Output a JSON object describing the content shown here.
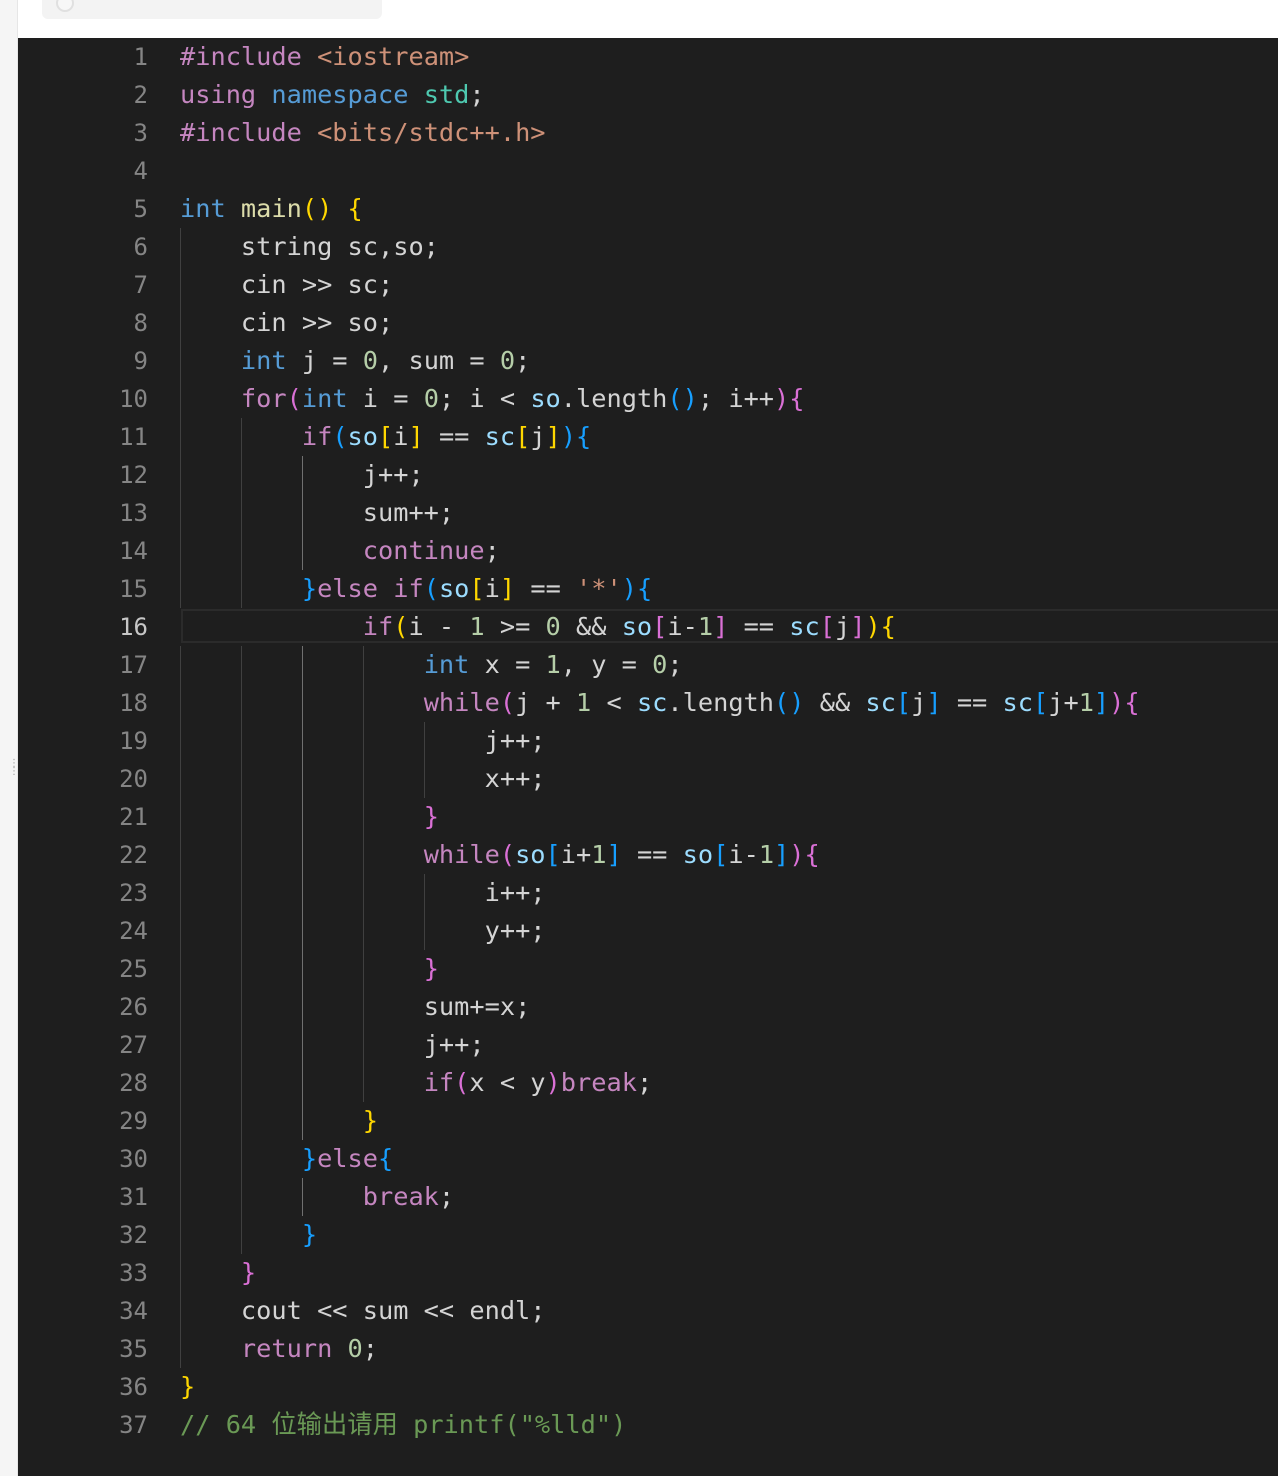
{
  "editor": {
    "active_line": 16,
    "lines": [
      [
        [
          "#include ",
          "#c586c0"
        ],
        [
          "<iostream>",
          "#ce9178"
        ]
      ],
      [
        [
          "using ",
          "#c586c0"
        ],
        [
          "namespace ",
          "#569cd6"
        ],
        [
          "std",
          "#4ec9b0"
        ],
        [
          ";",
          "#d4d4d4"
        ]
      ],
      [
        [
          "#include ",
          "#c586c0"
        ],
        [
          "<bits/stdc++.h>",
          "#ce9178"
        ]
      ],
      [],
      [
        [
          "int ",
          "#569cd6"
        ],
        [
          "main",
          "#dcdcaa"
        ],
        [
          "() ",
          "#ffd700"
        ],
        [
          "{",
          "#ffd700"
        ]
      ],
      [
        [
          "    ",
          "#d4d4d4"
        ],
        [
          "string sc,so;",
          "#d4d4d4"
        ]
      ],
      [
        [
          "    ",
          "#d4d4d4"
        ],
        [
          "cin >> sc;",
          "#d4d4d4"
        ]
      ],
      [
        [
          "    ",
          "#d4d4d4"
        ],
        [
          "cin >> so;",
          "#d4d4d4"
        ]
      ],
      [
        [
          "    ",
          "#d4d4d4"
        ],
        [
          "int ",
          "#569cd6"
        ],
        [
          "j = ",
          "#d4d4d4"
        ],
        [
          "0",
          "#b5cea8"
        ],
        [
          ", sum = ",
          "#d4d4d4"
        ],
        [
          "0",
          "#b5cea8"
        ],
        [
          ";",
          "#d4d4d4"
        ]
      ],
      [
        [
          "    ",
          "#d4d4d4"
        ],
        [
          "for",
          "#c586c0"
        ],
        [
          "(",
          "#da70d6"
        ],
        [
          "int ",
          "#569cd6"
        ],
        [
          "i = ",
          "#d4d4d4"
        ],
        [
          "0",
          "#b5cea8"
        ],
        [
          "; i < ",
          "#d4d4d4"
        ],
        [
          "so",
          "#9cdcfe"
        ],
        [
          ".length",
          "#d4d4d4"
        ],
        [
          "()",
          "#179fff"
        ],
        [
          "; i++",
          "#d4d4d4"
        ],
        [
          "){",
          "#da70d6"
        ]
      ],
      [
        [
          "        ",
          "#d4d4d4"
        ],
        [
          "if",
          "#c586c0"
        ],
        [
          "(",
          "#179fff"
        ],
        [
          "so",
          "#9cdcfe"
        ],
        [
          "[",
          "#ffd700"
        ],
        [
          "i",
          "#d4d4d4"
        ],
        [
          "]",
          "#ffd700"
        ],
        [
          " == ",
          "#d4d4d4"
        ],
        [
          "sc",
          "#9cdcfe"
        ],
        [
          "[",
          "#ffd700"
        ],
        [
          "j",
          "#d4d4d4"
        ],
        [
          "]",
          "#ffd700"
        ],
        [
          "){",
          "#179fff"
        ]
      ],
      [
        [
          "            ",
          "#d4d4d4"
        ],
        [
          "j++;",
          "#d4d4d4"
        ]
      ],
      [
        [
          "            ",
          "#d4d4d4"
        ],
        [
          "sum++;",
          "#d4d4d4"
        ]
      ],
      [
        [
          "            ",
          "#d4d4d4"
        ],
        [
          "continue",
          "#c586c0"
        ],
        [
          ";",
          "#d4d4d4"
        ]
      ],
      [
        [
          "        ",
          "#d4d4d4"
        ],
        [
          "}",
          "#179fff"
        ],
        [
          "else ",
          "#c586c0"
        ],
        [
          "if",
          "#c586c0"
        ],
        [
          "(",
          "#179fff"
        ],
        [
          "so",
          "#9cdcfe"
        ],
        [
          "[",
          "#ffd700"
        ],
        [
          "i",
          "#d4d4d4"
        ],
        [
          "]",
          "#ffd700"
        ],
        [
          " == ",
          "#d4d4d4"
        ],
        [
          "'*'",
          "#ce9178"
        ],
        [
          "){",
          "#179fff"
        ]
      ],
      [
        [
          "            ",
          "#d4d4d4"
        ],
        [
          "if",
          "#c586c0"
        ],
        [
          "(",
          "#ffd700"
        ],
        [
          "i - ",
          "#d4d4d4"
        ],
        [
          "1",
          "#b5cea8"
        ],
        [
          " >= ",
          "#d4d4d4"
        ],
        [
          "0",
          "#b5cea8"
        ],
        [
          " && ",
          "#d4d4d4"
        ],
        [
          "so",
          "#9cdcfe"
        ],
        [
          "[",
          "#da70d6"
        ],
        [
          "i-",
          "#d4d4d4"
        ],
        [
          "1",
          "#b5cea8"
        ],
        [
          "]",
          "#da70d6"
        ],
        [
          " == ",
          "#d4d4d4"
        ],
        [
          "sc",
          "#9cdcfe"
        ],
        [
          "[",
          "#da70d6"
        ],
        [
          "j",
          "#d4d4d4"
        ],
        [
          "]",
          "#da70d6"
        ],
        [
          "){",
          "#ffd700"
        ]
      ],
      [
        [
          "                ",
          "#d4d4d4"
        ],
        [
          "int ",
          "#569cd6"
        ],
        [
          "x = ",
          "#d4d4d4"
        ],
        [
          "1",
          "#b5cea8"
        ],
        [
          ", y = ",
          "#d4d4d4"
        ],
        [
          "0",
          "#b5cea8"
        ],
        [
          ";",
          "#d4d4d4"
        ]
      ],
      [
        [
          "                ",
          "#d4d4d4"
        ],
        [
          "while",
          "#c586c0"
        ],
        [
          "(",
          "#da70d6"
        ],
        [
          "j + ",
          "#d4d4d4"
        ],
        [
          "1",
          "#b5cea8"
        ],
        [
          " < ",
          "#d4d4d4"
        ],
        [
          "sc",
          "#9cdcfe"
        ],
        [
          ".length",
          "#d4d4d4"
        ],
        [
          "()",
          "#179fff"
        ],
        [
          " && ",
          "#d4d4d4"
        ],
        [
          "sc",
          "#9cdcfe"
        ],
        [
          "[",
          "#179fff"
        ],
        [
          "j",
          "#d4d4d4"
        ],
        [
          "]",
          "#179fff"
        ],
        [
          " == ",
          "#d4d4d4"
        ],
        [
          "sc",
          "#9cdcfe"
        ],
        [
          "[",
          "#179fff"
        ],
        [
          "j+",
          "#d4d4d4"
        ],
        [
          "1",
          "#b5cea8"
        ],
        [
          "]",
          "#179fff"
        ],
        [
          "){",
          "#da70d6"
        ]
      ],
      [
        [
          "                    ",
          "#d4d4d4"
        ],
        [
          "j++;",
          "#d4d4d4"
        ]
      ],
      [
        [
          "                    ",
          "#d4d4d4"
        ],
        [
          "x++;",
          "#d4d4d4"
        ]
      ],
      [
        [
          "                ",
          "#d4d4d4"
        ],
        [
          "}",
          "#da70d6"
        ]
      ],
      [
        [
          "                ",
          "#d4d4d4"
        ],
        [
          "while",
          "#c586c0"
        ],
        [
          "(",
          "#da70d6"
        ],
        [
          "so",
          "#9cdcfe"
        ],
        [
          "[",
          "#179fff"
        ],
        [
          "i+",
          "#d4d4d4"
        ],
        [
          "1",
          "#b5cea8"
        ],
        [
          "]",
          "#179fff"
        ],
        [
          " == ",
          "#d4d4d4"
        ],
        [
          "so",
          "#9cdcfe"
        ],
        [
          "[",
          "#179fff"
        ],
        [
          "i-",
          "#d4d4d4"
        ],
        [
          "1",
          "#b5cea8"
        ],
        [
          "]",
          "#179fff"
        ],
        [
          "){",
          "#da70d6"
        ]
      ],
      [
        [
          "                    ",
          "#d4d4d4"
        ],
        [
          "i++;",
          "#d4d4d4"
        ]
      ],
      [
        [
          "                    ",
          "#d4d4d4"
        ],
        [
          "y++;",
          "#d4d4d4"
        ]
      ],
      [
        [
          "                ",
          "#d4d4d4"
        ],
        [
          "}",
          "#da70d6"
        ]
      ],
      [
        [
          "                ",
          "#d4d4d4"
        ],
        [
          "sum+=x;",
          "#d4d4d4"
        ]
      ],
      [
        [
          "                ",
          "#d4d4d4"
        ],
        [
          "j++;",
          "#d4d4d4"
        ]
      ],
      [
        [
          "                ",
          "#d4d4d4"
        ],
        [
          "if",
          "#c586c0"
        ],
        [
          "(",
          "#da70d6"
        ],
        [
          "x < y",
          "#d4d4d4"
        ],
        [
          ")",
          "#da70d6"
        ],
        [
          "break",
          "#c586c0"
        ],
        [
          ";",
          "#d4d4d4"
        ]
      ],
      [
        [
          "            ",
          "#d4d4d4"
        ],
        [
          "}",
          "#ffd700"
        ]
      ],
      [
        [
          "        ",
          "#d4d4d4"
        ],
        [
          "}",
          "#179fff"
        ],
        [
          "else",
          "#c586c0"
        ],
        [
          "{",
          "#179fff"
        ]
      ],
      [
        [
          "            ",
          "#d4d4d4"
        ],
        [
          "break",
          "#c586c0"
        ],
        [
          ";",
          "#d4d4d4"
        ]
      ],
      [
        [
          "        ",
          "#d4d4d4"
        ],
        [
          "}",
          "#179fff"
        ]
      ],
      [
        [
          "    ",
          "#d4d4d4"
        ],
        [
          "}",
          "#da70d6"
        ]
      ],
      [
        [
          "    ",
          "#d4d4d4"
        ],
        [
          "cout << sum << endl;",
          "#d4d4d4"
        ]
      ],
      [
        [
          "    ",
          "#d4d4d4"
        ],
        [
          "return ",
          "#c586c0"
        ],
        [
          "0",
          "#b5cea8"
        ],
        [
          ";",
          "#d4d4d4"
        ]
      ],
      [
        [
          "}",
          "#ffd700"
        ]
      ],
      [
        [
          "// 64 位输出请用 printf(\"%lld\")",
          "#6a9955"
        ]
      ]
    ]
  },
  "colors": {
    "background": "#1e1e1e",
    "line_number": "#858585",
    "active_line_number": "#c6c6c6",
    "indent_guide": "#404040"
  }
}
